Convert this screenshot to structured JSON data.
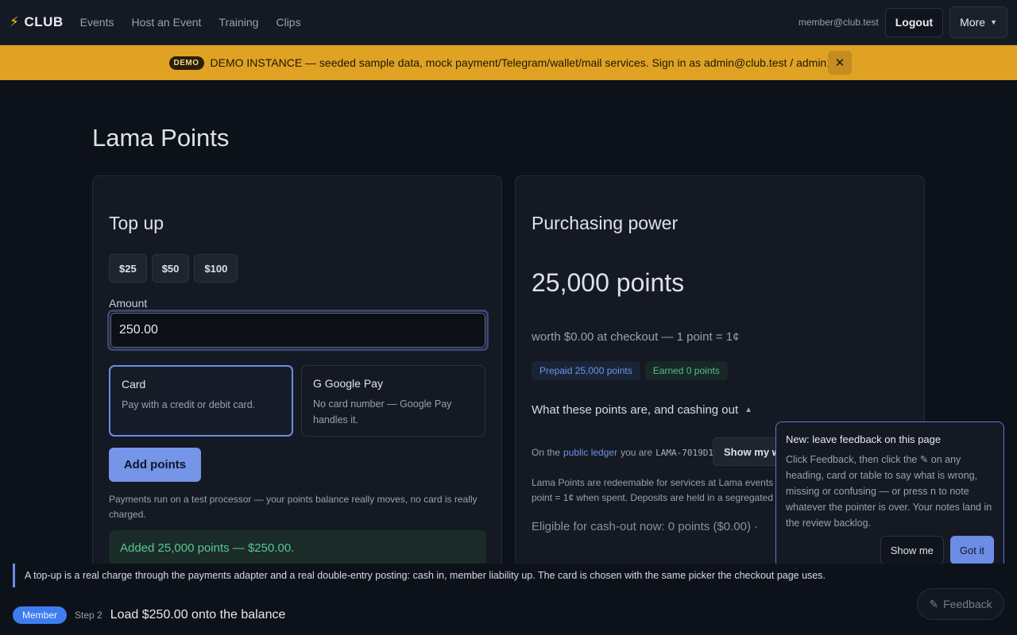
{
  "nav": {
    "brand": "CLUB",
    "links": [
      "Events",
      "Host an Event",
      "Training",
      "Clips"
    ],
    "email": "member@club.test",
    "logout": "Logout",
    "more": "More"
  },
  "banner": {
    "tag": "DEMO",
    "text": "DEMO INSTANCE — seeded sample data, mock payment/Telegram/wallet/mail services. Sign in as admin@club.test / admin123.",
    "close": "✕"
  },
  "page": {
    "title": "Lama Points"
  },
  "topup": {
    "title": "Top up",
    "presets": [
      "$25",
      "$50",
      "$100"
    ],
    "amount_label": "Amount",
    "amount_value": "250.00",
    "methods": [
      {
        "title": "Card",
        "desc": "Pay with a credit or debit card."
      },
      {
        "title": "G Google Pay",
        "desc": "No card number — Google Pay handles it."
      }
    ],
    "add_button": "Add points",
    "note": "Payments run on a test processor — your points balance really moves, no card is really charged.",
    "success": "Added 25,000 points — $250.00."
  },
  "power": {
    "title": "Purchasing power",
    "points": "25,000 points",
    "worth": "worth $0.00 at checkout — 1 point = 1¢",
    "badge_prepaid": "Prepaid 25,000 points",
    "badge_earned": "Earned 0 points",
    "details": "What these points are, and cashing out",
    "ledger_prefix": "On the",
    "ledger_link": "public ledger",
    "ledger_mid": "you are",
    "ledger_id": "LAMA-7019D1A4.",
    "show_button": "Show my w",
    "redeem": "Lama Points are redeemable for services at Lama events a point = 1¢ when spent. Deposits are held in a segregated",
    "eligible": "Eligible for cash-out now: 0 points ($0.00) ·"
  },
  "popover": {
    "title": "New: leave feedback on this page",
    "body": "Click Feedback, then click the ✎ on any heading, card or table to say what is wrong, missing or confusing — or press n to note whatever the pointer is over. Your notes land in the review backlog.",
    "show": "Show me",
    "got": "Got it"
  },
  "tour": {
    "message": "A top-up is a real charge through the payments adapter and a real double-entry posting: cash in, member liability up. The card is chosen with the same picker the checkout page uses.",
    "role": "Member",
    "step": "Step 2",
    "step_title": "Load $250.00 onto the balance"
  },
  "feedback_fab": "Feedback"
}
